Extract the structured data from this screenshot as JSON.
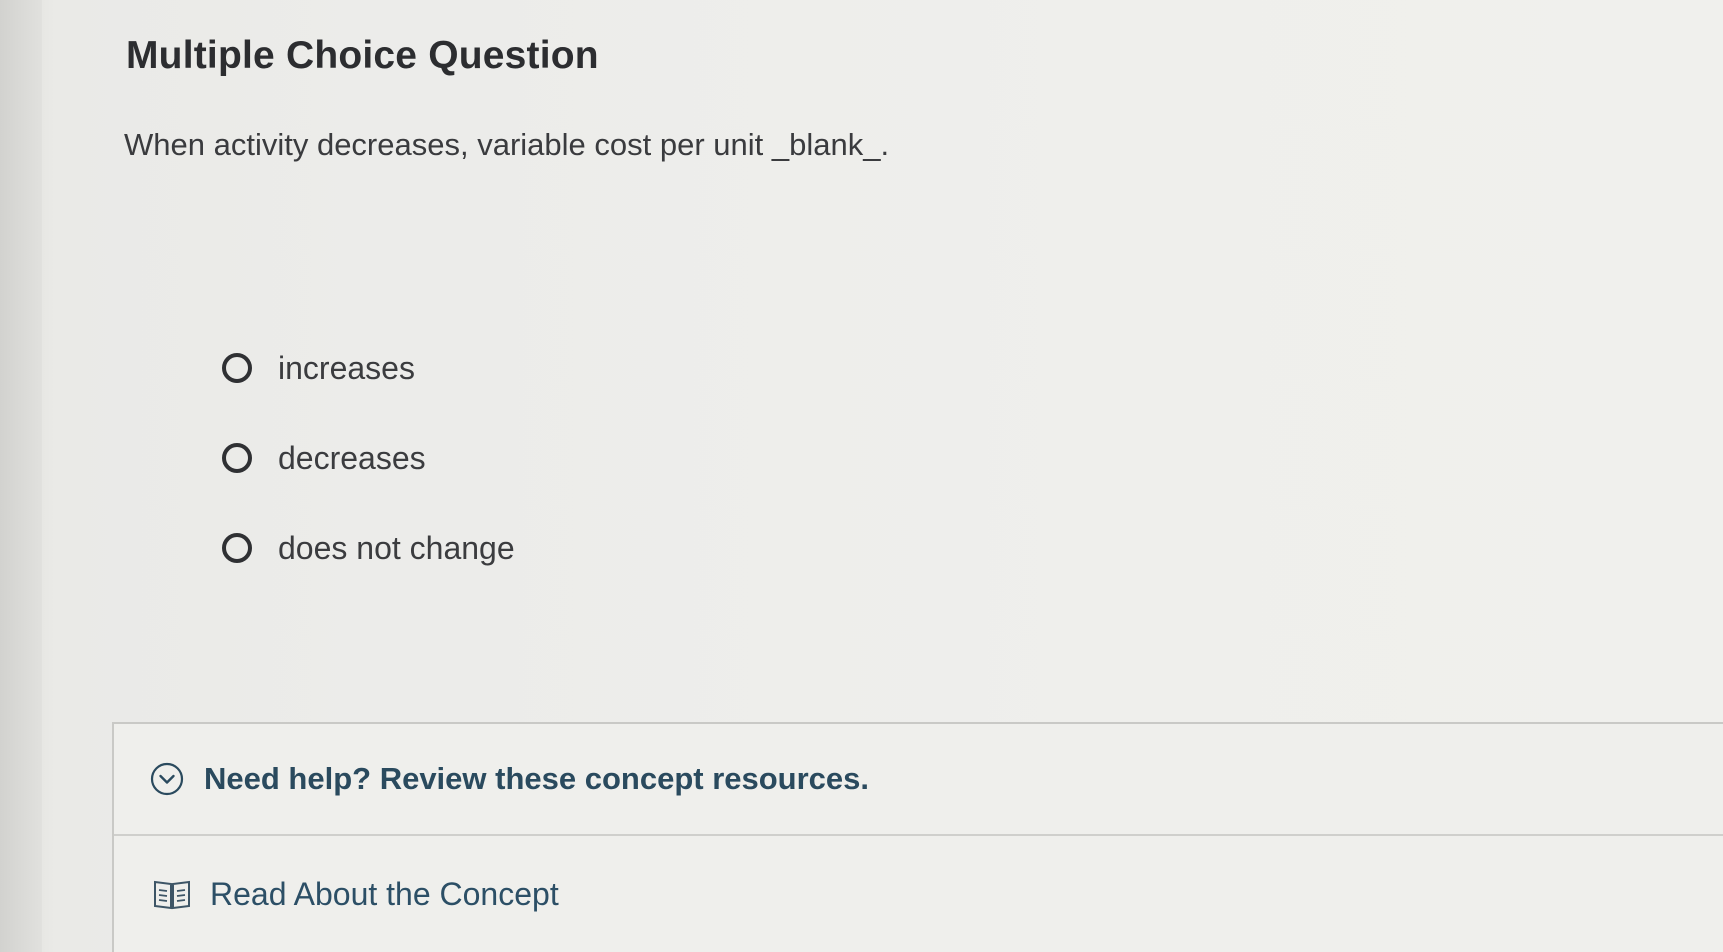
{
  "header": {
    "title": "Multiple Choice Question"
  },
  "question": {
    "text": "When activity decreases, variable cost per unit _blank_."
  },
  "options": [
    {
      "label": "increases"
    },
    {
      "label": "decreases"
    },
    {
      "label": "does not change"
    }
  ],
  "help": {
    "toggle_label": "Need help? Review these concept resources.",
    "toggle_icon": "chevron-down-circle-icon",
    "resource_label": "Read About the Concept",
    "resource_icon": "book-icon"
  },
  "colors": {
    "link_text": "#2a4a5e",
    "text": "#3a3b3e"
  }
}
